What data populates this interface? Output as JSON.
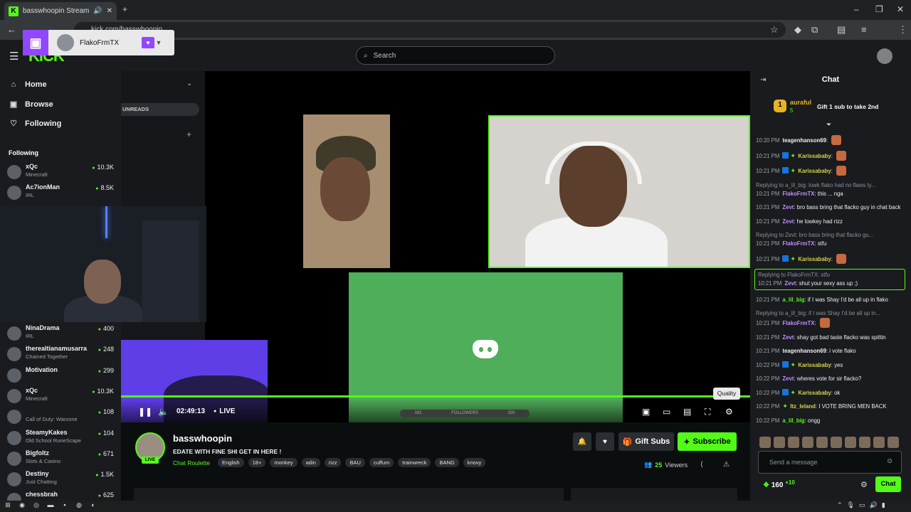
{
  "browser": {
    "tab_title": "basswhoopin Stream - Wat",
    "url": "kick.com/basswhoopin",
    "favicon": "K"
  },
  "twitch_overlay": {
    "streamer": "FlakoFrmTX"
  },
  "header": {
    "logo": "KICK",
    "search_placeholder": "Search"
  },
  "sidebar": {
    "nav": [
      {
        "label": "Home",
        "icon": "home-icon"
      },
      {
        "label": "Browse",
        "icon": "browse-icon"
      },
      {
        "label": "Following",
        "icon": "heart-icon"
      }
    ],
    "following_title": "Following",
    "following_top": [
      {
        "name": "xQc",
        "category": "Minecraft",
        "viewers": "10.3K"
      },
      {
        "name": "Ac7ionMan",
        "category": "IRL",
        "viewers": "8.5K"
      }
    ],
    "following_bottom": [
      {
        "name": "NinaDrama",
        "category": "IRL",
        "viewers": "400"
      },
      {
        "name": "therealtianamusarra",
        "category": "Chained Together",
        "viewers": "248"
      },
      {
        "name": "Motivation",
        "category": "",
        "viewers": "299"
      },
      {
        "name": "xQc",
        "category": "Minecraft",
        "viewers": "10.3K"
      },
      {
        "name": "",
        "category": "Call of Duty: Warzone",
        "viewers": "108"
      },
      {
        "name": "SteamyKakes",
        "category": "Old School RuneScape",
        "viewers": "104"
      },
      {
        "name": "Bigfoltz",
        "category": "Slots & Casino",
        "viewers": "671"
      },
      {
        "name": "Destiny",
        "category": "Just Chatting",
        "viewers": "1.5K"
      },
      {
        "name": "chessbrah",
        "category": "",
        "viewers": "625"
      }
    ]
  },
  "inner_panel": {
    "unreads": "UNREADS"
  },
  "player": {
    "time": "02:49:13",
    "live": "LIVE",
    "followers_label": "FOLLOWERS",
    "followers_left": "191",
    "followers_right": "200",
    "tooltip": "Quality"
  },
  "channel": {
    "name": "basswhoopin",
    "title": "EDATE WITH FINE SHI GET IN HERE !",
    "category": "Chat Roulette",
    "live_badge": "LIVE",
    "tags": [
      "English",
      "18+",
      "monkey",
      "adin",
      "rizz",
      "BAU",
      "cuffum",
      "trainwreck",
      "BANG",
      "knovy"
    ],
    "gift_subs": "Gift Subs",
    "subscribe": "Subscribe",
    "viewers_count": "25",
    "viewers_label": "Viewers"
  },
  "chat": {
    "title": "Chat",
    "leader_rank": "1",
    "leader_name": "auraful",
    "leader_count": "5",
    "leader_cta": "Gift 1 sub to take 2nd",
    "messages": [
      {
        "time": "10:20 PM",
        "user": "teagenhanson69",
        "color": "#f0f0f0",
        "text": "",
        "emote": true
      },
      {
        "time": "10:21 PM",
        "user": "Karissababy",
        "color": "#d7d24a",
        "text": "",
        "badges": true,
        "emote": true
      },
      {
        "time": "10:21 PM",
        "user": "Karissababy",
        "color": "#d7d24a",
        "text": "",
        "badges": true,
        "emote": true
      },
      {
        "reply": "Replying to a_lil_big: lowk flako had no flaws ty...",
        "time": "10:21 PM",
        "user": "FlakoFrmTX",
        "color": "#c58bff",
        "text": "this ... nga"
      },
      {
        "time": "10:21 PM",
        "user": "Zevt",
        "color": "#c58bff",
        "text": "bro bass bring that flacko guy in chat back"
      },
      {
        "time": "10:21 PM",
        "user": "Zevt",
        "color": "#c58bff",
        "text": "he lowkey had rizz"
      },
      {
        "reply": "Replying to Zevt: bro bass bring that flacko gu...",
        "time": "10:21 PM",
        "user": "FlakoFrmTX",
        "color": "#c58bff",
        "text": "stfu"
      },
      {
        "time": "10:21 PM",
        "user": "Karissababy",
        "color": "#d7d24a",
        "text": "",
        "badges": true,
        "emote": true
      },
      {
        "reply": "Replying to FlakoFrmTX: stfu",
        "time": "10:21 PM",
        "user": "Zevt",
        "color": "#c58bff",
        "text": "shut your sexy ass up ;)",
        "highlight": true
      },
      {
        "time": "10:21 PM",
        "user": "a_lil_big",
        "color": "#53fc18",
        "text": "if I was Shay I'd be all up in flako"
      },
      {
        "reply": "Replying to a_lil_big: if I was Shay I'd be all up in...",
        "time": "10:21 PM",
        "user": "FlakoFrmTX",
        "color": "#c58bff",
        "text": "",
        "emote": true
      },
      {
        "time": "10:21 PM",
        "user": "Zevt",
        "color": "#c58bff",
        "text": "shay got bad taste flacko was spittin"
      },
      {
        "time": "10:21 PM",
        "user": "teagenhanson69",
        "color": "#f0f0f0",
        "text": "i vote flako"
      },
      {
        "time": "10:22 PM",
        "user": "Karissababy",
        "color": "#d7d24a",
        "text": "yes",
        "badges": true
      },
      {
        "time": "10:22 PM",
        "user": "Zevt",
        "color": "#c58bff",
        "text": "wheres vote for sir flacko?"
      },
      {
        "time": "10:22 PM",
        "user": "Karissababy",
        "color": "#d7d24a",
        "text": "ok",
        "badges": true
      },
      {
        "time": "10:22 PM",
        "user": "Itz_leland",
        "color": "#d7d24a",
        "text": "I VOTE BRING MEN BACK",
        "gbadge": true
      },
      {
        "time": "10:22 PM",
        "user": "a_lil_big",
        "color": "#53fc18",
        "text": "ongg"
      }
    ],
    "input_placeholder": "Send a message",
    "points": "160",
    "points_delta": "+10",
    "send_label": "Chat"
  },
  "colors": {
    "accent": "#53fc18",
    "background": "#0b0e0f",
    "panel": "#191b1f",
    "twitch": "#9147ff"
  }
}
